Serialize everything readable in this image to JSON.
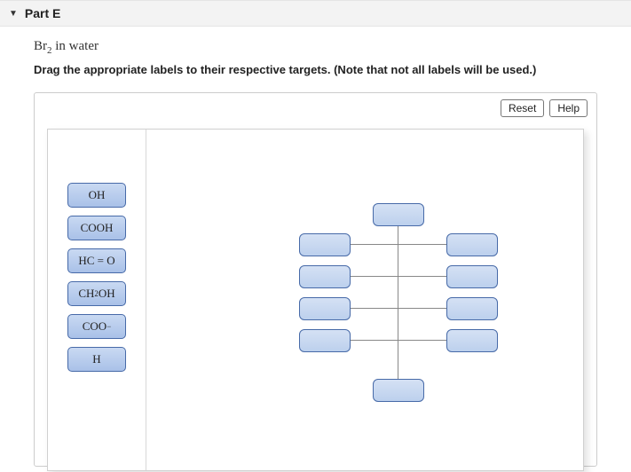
{
  "header": {
    "title": "Part E"
  },
  "prompt": {
    "reagent_base": "Br",
    "reagent_sub": "2",
    "reagent_tail": " in water",
    "instruction": "Drag the appropriate labels to their respective targets. (Note that not all labels will be used.)"
  },
  "controls": {
    "reset": "Reset",
    "help": "Help"
  },
  "labels": {
    "l0": "OH",
    "l1": "COOH",
    "l2_a": "HC",
    "l2_b": "O",
    "l3_a": "CH",
    "l3_sub": "2",
    "l3_b": "OH",
    "l4_a": "COO",
    "l4_sup": "−",
    "l5": "H"
  }
}
